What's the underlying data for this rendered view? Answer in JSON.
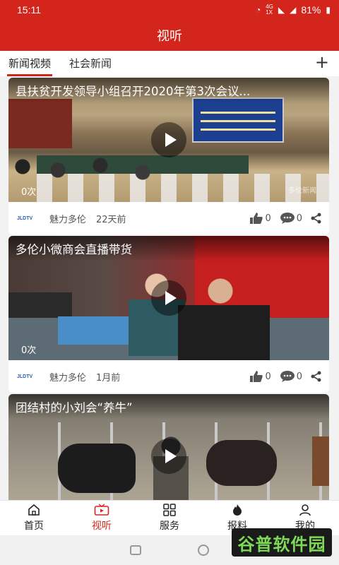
{
  "status_bar": {
    "time": "15:11",
    "network_top": "4G",
    "network_bottom": "1X",
    "battery": "81%"
  },
  "header": {
    "title": "视听"
  },
  "tabs": [
    {
      "label": "新闻视频",
      "active": true
    },
    {
      "label": "社会新闻",
      "active": false
    }
  ],
  "tab_add_glyph": "+",
  "feed": [
    {
      "title": "县扶贫开发领导小组召开2020年第3次会议...",
      "views": "0次",
      "source": "魅力多伦",
      "time": "22天前",
      "likes": "0",
      "comments": "0",
      "thumb_watermark": "多伦新闻"
    },
    {
      "title": "多伦小微商会直播带货",
      "views": "0次",
      "source": "魅力多伦",
      "time": "1月前",
      "likes": "0",
      "comments": "0"
    },
    {
      "title": "团结村的小刘会“养牛”"
    }
  ],
  "source_logo_text": "JLDTV",
  "bottom_nav": [
    {
      "label": "首页",
      "icon": "home-icon",
      "active": false
    },
    {
      "label": "视听",
      "icon": "tv-icon",
      "active": true
    },
    {
      "label": "服务",
      "icon": "grid-icon",
      "active": false
    },
    {
      "label": "报料",
      "icon": "flame-icon",
      "active": false
    },
    {
      "label": "我的",
      "icon": "user-icon",
      "active": false
    }
  ],
  "site_watermark": "谷普软件园",
  "colors": {
    "brand_red": "#d3251b",
    "background": "#f2f2f2"
  }
}
